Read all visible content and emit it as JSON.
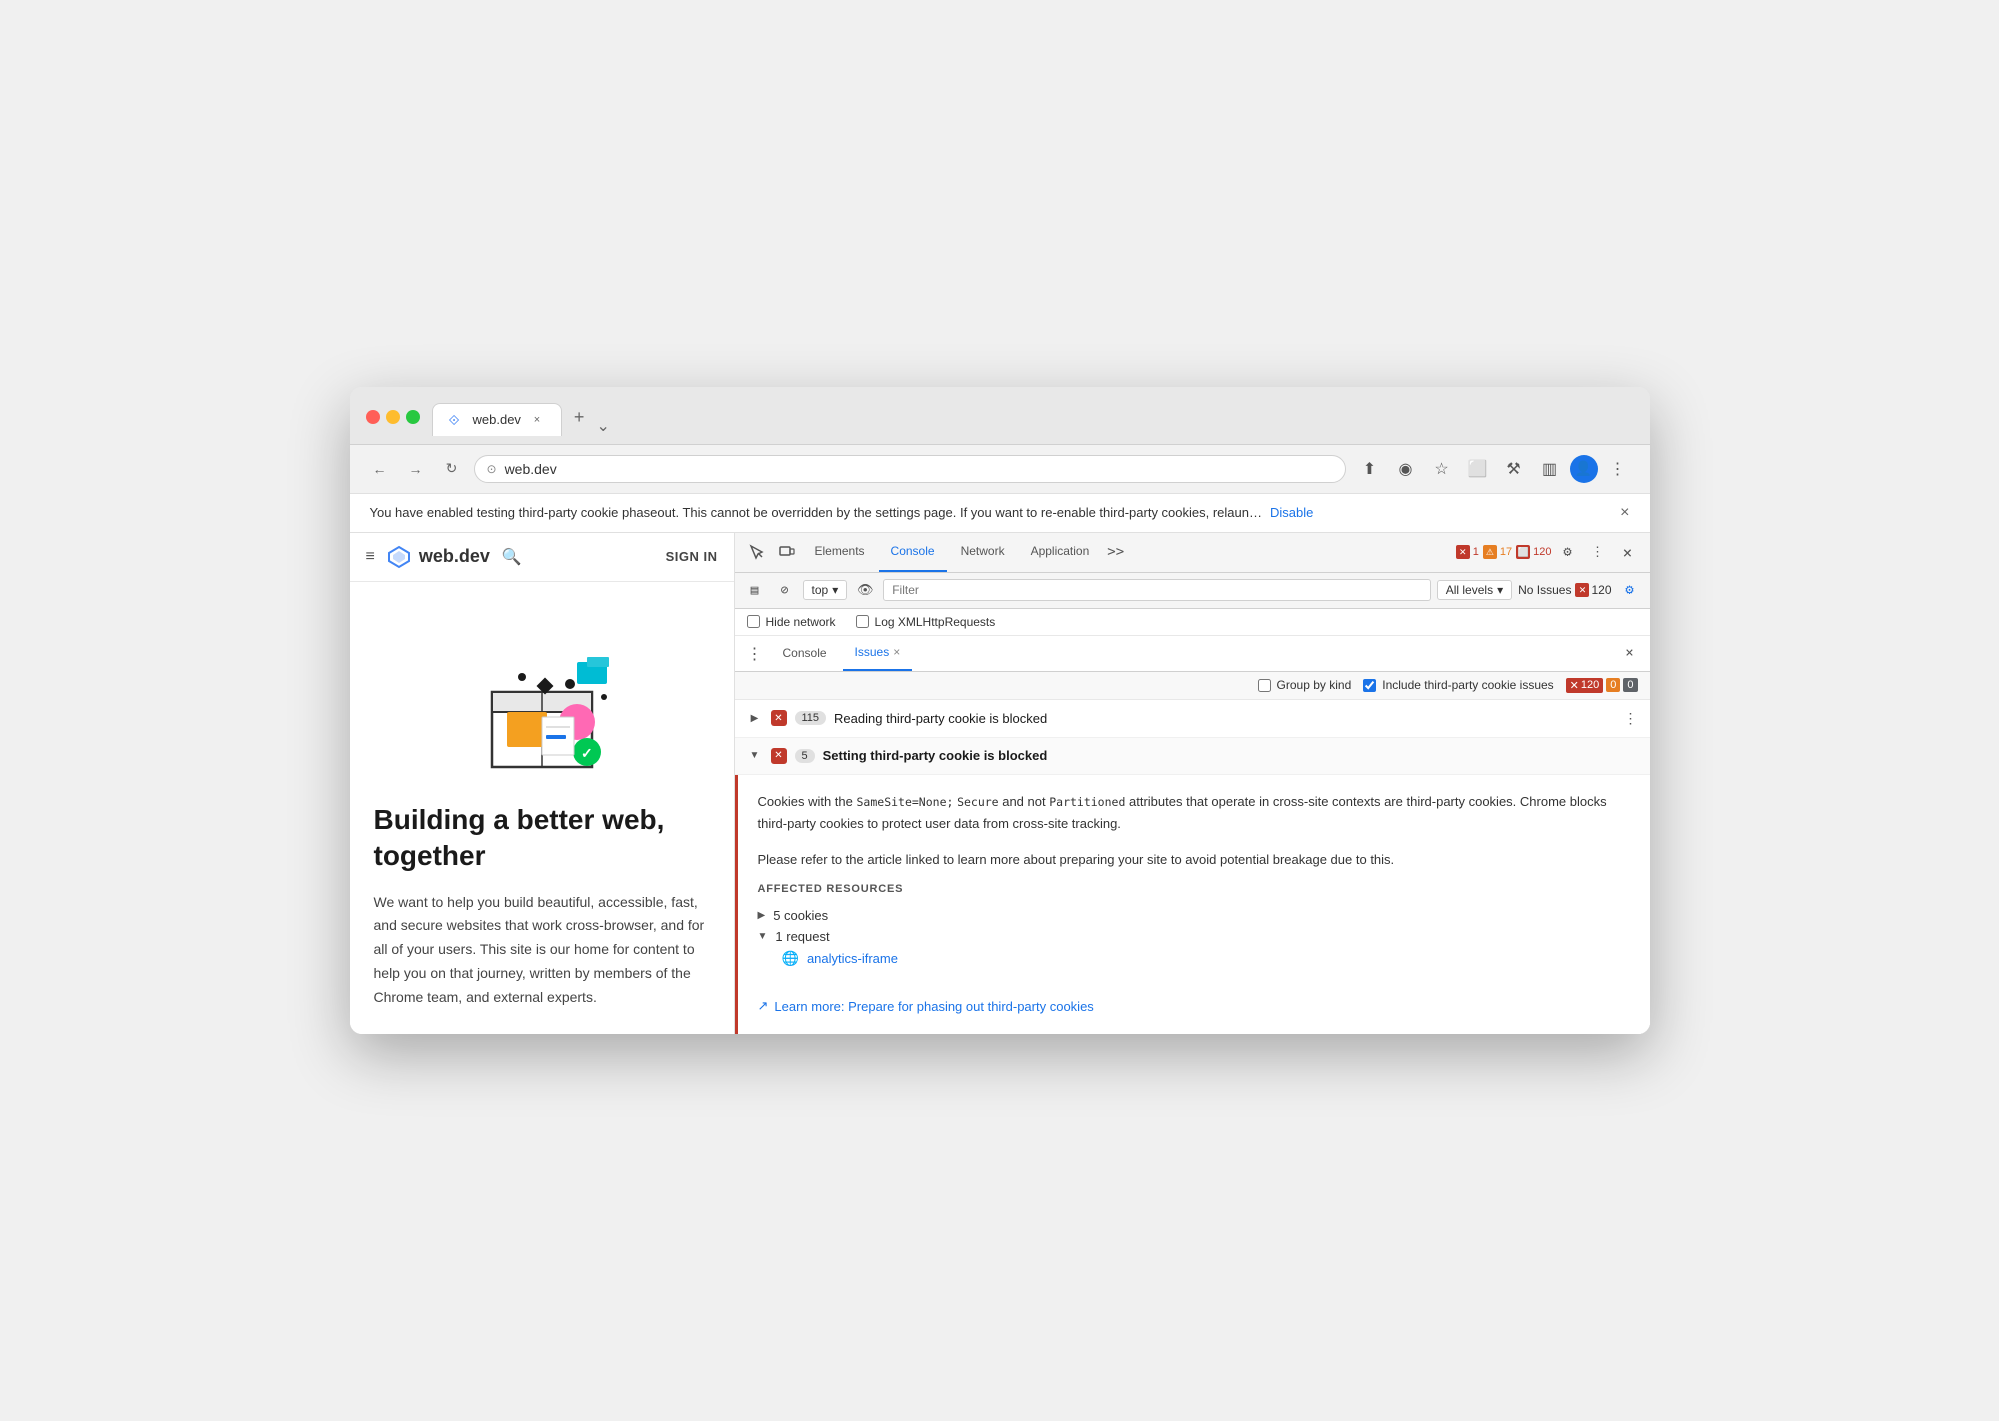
{
  "browser": {
    "tab_title": "web.dev",
    "tab_url": "web.dev",
    "new_tab_btn": "+",
    "expand_btn": "⌄"
  },
  "nav": {
    "back_btn": "←",
    "forward_btn": "→",
    "refresh_btn": "↻",
    "address": "web.dev",
    "screen_share_icon": "⬆",
    "eye_slash_icon": "◎",
    "star_icon": "☆",
    "extension_icon": "⬜",
    "profile_icon": "⚙",
    "more_icon": "⋮"
  },
  "info_bar": {
    "message": "You have enabled testing third-party cookie phaseout. This cannot be overridden by the settings page. If you want to re-enable third-party cookies, relaun…",
    "disable_link": "Disable",
    "close": "×"
  },
  "website": {
    "hamburger": "≡",
    "logo_text": "web.dev",
    "search_icon": "🔍",
    "sign_in": "SIGN IN",
    "hero_title": "Building a better web, together",
    "hero_text": "We want to help you build beautiful, accessible, fast, and secure websites that work cross-browser, and for all of your users. This site is our home for content to help you on that journey, written by members of the Chrome team, and external experts."
  },
  "devtools": {
    "toolbar": {
      "inspect_icon": "⊹",
      "device_icon": "⬜",
      "tabs": [
        "Elements",
        "Console",
        "Network",
        "Application"
      ],
      "active_tab": "Console",
      "more_tabs": ">>",
      "badge_error_count": "1",
      "badge_warn_count": "17",
      "badge_info_count": "120",
      "settings_icon": "⚙",
      "more_icon": "⋮",
      "close_icon": "×"
    },
    "console_toolbar": {
      "sidebar_icon": "▤",
      "clear_icon": "⊘",
      "filter_value": "top",
      "eye_icon": "👁",
      "filter_placeholder": "Filter",
      "levels_label": "All levels",
      "no_issues_label": "No Issues",
      "no_issues_count": "120",
      "settings_icon": "⚙"
    },
    "checkbox_row": {
      "hide_network_label": "Hide network",
      "log_xml_label": "Log XMLHttpRequests"
    },
    "issues_tabs": {
      "menu_icon": "⋮",
      "console_tab": "Console",
      "issues_tab": "Issues",
      "close_tab": "×",
      "close_panel_icon": "×"
    },
    "issues_filter": {
      "group_by_kind_label": "Group by kind",
      "include_third_party_label": "Include third-party cookie issues",
      "count_red": "120",
      "count_orange": "0",
      "count_blue": "0"
    },
    "issues": [
      {
        "id": "reading-blocked",
        "title": "Reading third-party cookie is blocked",
        "count": "115",
        "expanded": false,
        "icon": "✕"
      },
      {
        "id": "setting-blocked",
        "title": "Setting third-party cookie is blocked",
        "count": "5",
        "expanded": true,
        "icon": "✕",
        "detail_paragraphs": [
          "Cookies with the SameSite=None; Secure and not Partitioned attributes that operate in cross-site contexts are third-party cookies. Chrome blocks third-party cookies to protect user data from cross-site tracking.",
          "Please refer to the article linked to learn more about preparing your site to avoid potential breakage due to this."
        ],
        "code_parts": [
          "SameSite=None;",
          "Secure",
          "Partitioned"
        ],
        "affected_resources_title": "AFFECTED RESOURCES",
        "cookies_item": "5 cookies",
        "cookies_expanded": false,
        "request_item": "1 request",
        "request_expanded": true,
        "request_child": "analytics-iframe",
        "learn_more_text": "Learn more: Prepare for phasing out third-party cookies",
        "learn_more_url": "#"
      }
    ]
  }
}
